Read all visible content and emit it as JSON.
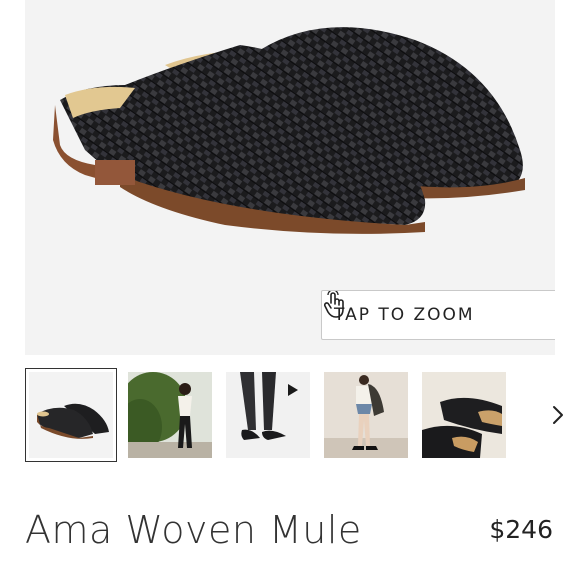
{
  "product": {
    "name": "Ama Woven Mule",
    "price": "$246"
  },
  "gallery": {
    "zoom_label": "TAP TO ZOOM",
    "zoom_icon": "tap-hand-icon",
    "next_icon": "chevron-right-icon",
    "thumbnails": [
      {
        "name": "thumbnail-shoes-pair",
        "selected": true
      },
      {
        "name": "thumbnail-model-garden"
      },
      {
        "name": "thumbnail-video-legs",
        "video": true
      },
      {
        "name": "thumbnail-model-coat"
      },
      {
        "name": "thumbnail-shoes-closeup"
      }
    ]
  }
}
